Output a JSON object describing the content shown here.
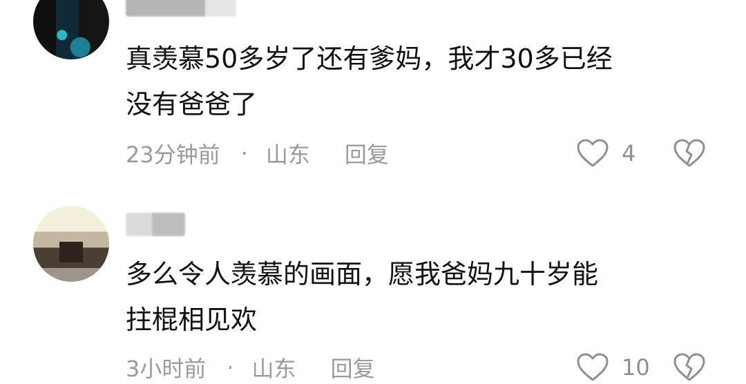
{
  "comments": [
    {
      "text_line1": "真羡慕50多岁了还有爹妈，我才30多已经",
      "text_line2": "没有爸爸了",
      "time": "23分钟前",
      "separator": "·",
      "location": "山东",
      "reply": "回复",
      "likes": "4"
    },
    {
      "text_line1": "多么令人羡慕的画面，愿我爸妈九十岁能",
      "text_line2": "拄棍相见欢",
      "time": "3小时前",
      "separator": "·",
      "location": "山东",
      "reply": "回复",
      "likes": "10"
    }
  ],
  "icons": {
    "like": "heart-outline-icon",
    "dislike": "broken-heart-icon"
  }
}
